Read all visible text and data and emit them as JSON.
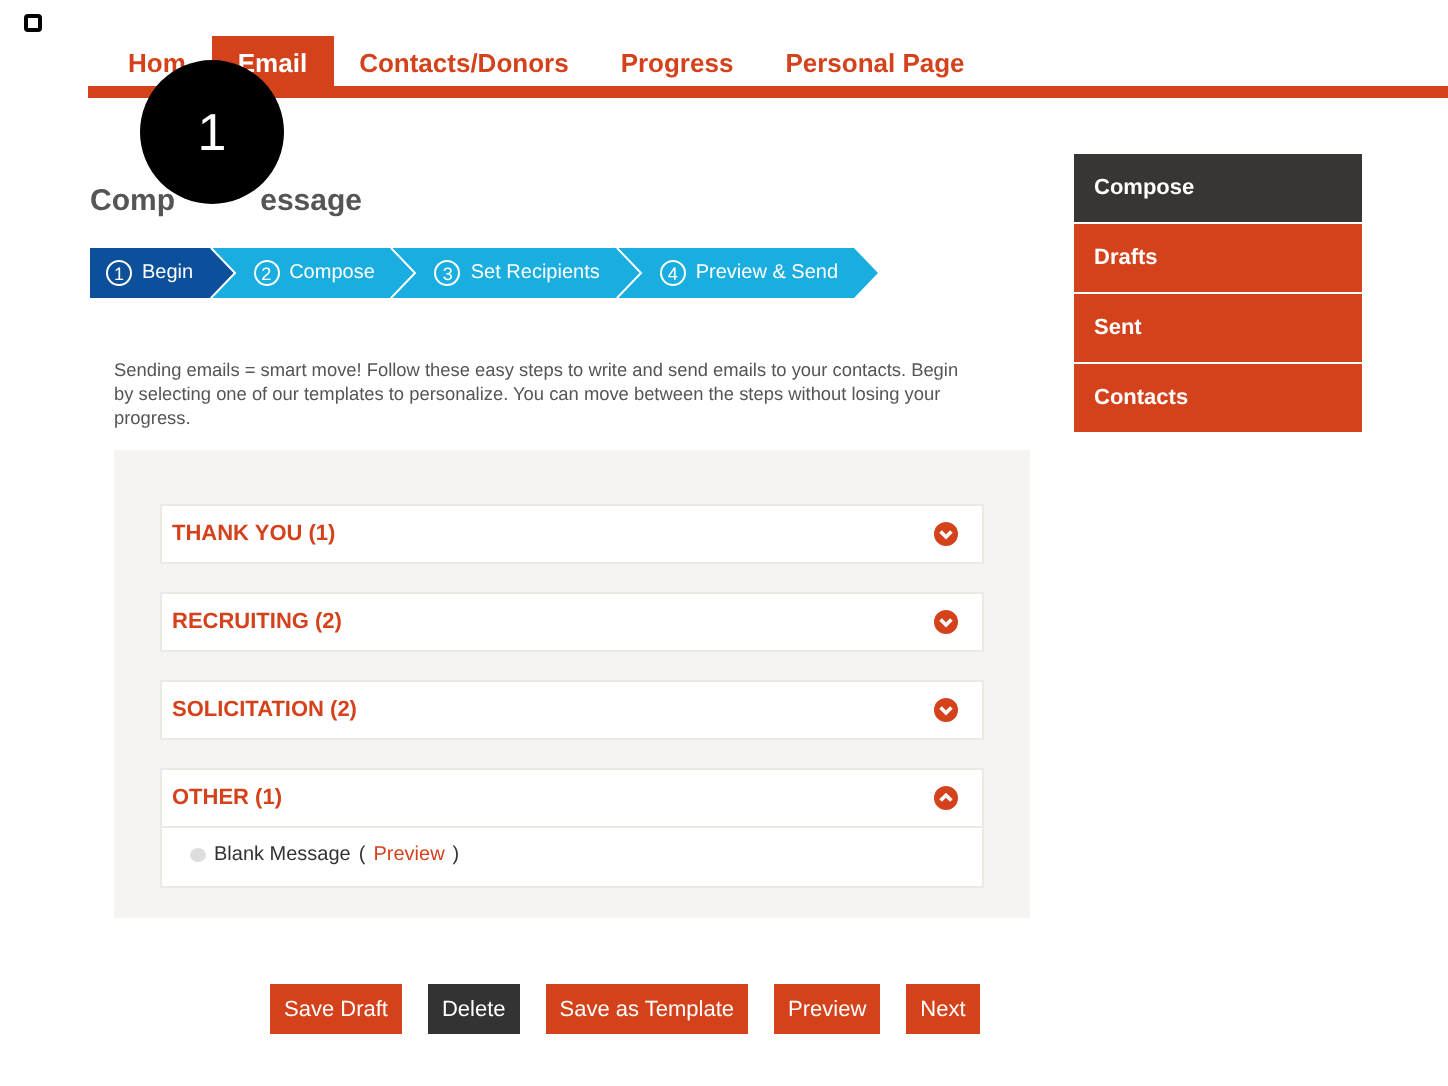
{
  "nav": [
    {
      "label": "Hom",
      "selected": false
    },
    {
      "label": "Email",
      "selected": true
    },
    {
      "label": "Contacts/Donors",
      "selected": false
    },
    {
      "label": "Progress",
      "selected": false
    },
    {
      "label": "Personal Page",
      "selected": false
    }
  ],
  "callout": "1",
  "title": [
    "Comp",
    "essage"
  ],
  "steps": [
    {
      "number": "1",
      "label": "Begin",
      "selected": true
    },
    {
      "number": "2",
      "label": "Compose",
      "selected": false
    },
    {
      "number": "3",
      "label": "Set Recipients",
      "selected": false
    },
    {
      "number": "4",
      "label": "Preview & Send",
      "selected": false
    }
  ],
  "intro": "Sending emails = smart move! Follow these easy steps to write and send emails to your contacts. Begin by selecting one of our templates to personalize. You can move between the steps without losing your progress.",
  "categories": [
    {
      "label": "THANK YOU (1)",
      "expanded": false
    },
    {
      "label": "RECRUITING (2)",
      "expanded": false
    },
    {
      "label": "SOLICITATION (2)",
      "expanded": false
    },
    {
      "label": "OTHER (1)",
      "expanded": true,
      "templates": [
        {
          "name": "Blank Message",
          "selected": false,
          "open": "(",
          "link": "Preview",
          "close": ")"
        }
      ]
    }
  ],
  "sidebar": [
    {
      "label": "Compose",
      "selected": true
    },
    {
      "label": "Drafts",
      "selected": false
    },
    {
      "label": "Sent",
      "selected": false
    },
    {
      "label": "Contacts",
      "selected": false
    }
  ],
  "buttons": [
    {
      "label": "Save Draft",
      "kind": "primary"
    },
    {
      "label": "Delete",
      "kind": "dark"
    },
    {
      "label": "Save as Template",
      "kind": "primary"
    },
    {
      "label": "Preview",
      "kind": "primary"
    },
    {
      "label": "Next",
      "kind": "primary"
    }
  ]
}
